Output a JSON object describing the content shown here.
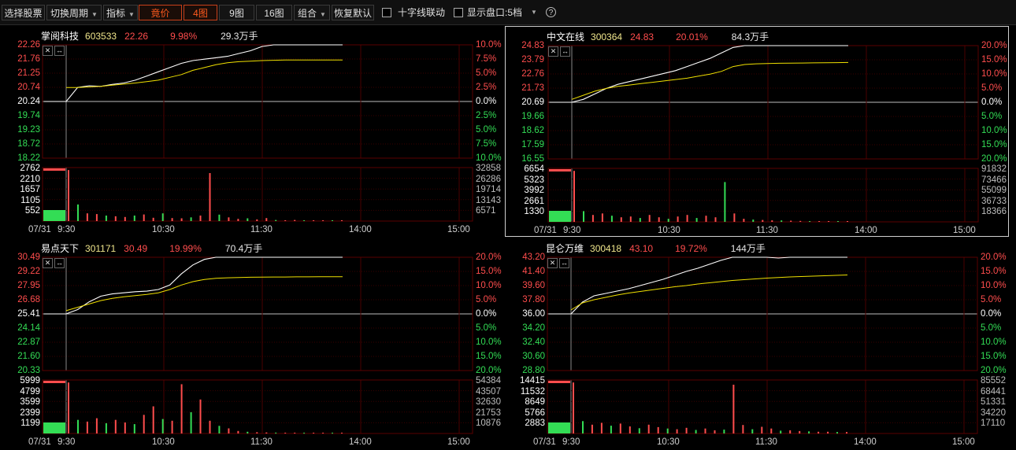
{
  "toolbar": {
    "select_stock": "选择股票",
    "switch_period": "切换周期",
    "indicator": "指标",
    "auction": "竟价",
    "grid4": "4图",
    "grid9": "9图",
    "grid16": "16图",
    "combo": "组合",
    "restore": "恢复默认",
    "crosshair_label": "十字线联动",
    "show_depth_label": "显示盘口:5档",
    "help": "?"
  },
  "colors": {
    "up": "#ff4d4d",
    "down": "#33dd55",
    "price_line": "#ffffff",
    "avg_line": "#f0e000",
    "grid": "#3a0000"
  },
  "time_labels": [
    "9:30",
    "10:30",
    "11:30",
    "14:00",
    "15:00"
  ],
  "panels": [
    {
      "name": "掌阅科技",
      "code": "603533",
      "price": "22.26",
      "pct": "9.98%",
      "vol": "29.3万手",
      "date": "07/31",
      "selected": false,
      "left_prices": [
        "22.26",
        "21.76",
        "21.25",
        "20.74",
        "20.24",
        "19.74",
        "19.23",
        "18.72",
        "18.22"
      ],
      "right_pcts": [
        "10.0%",
        "7.5%",
        "5.0%",
        "2.5%",
        "0.0%",
        "2.5%",
        "5.0%",
        "7.5%",
        "10.0%"
      ],
      "vol_left": [
        "2762",
        "2210",
        "1657",
        "1105",
        "552"
      ],
      "vol_right": [
        "32858",
        "26286",
        "19714",
        "13143",
        "6571"
      ],
      "price_series": [
        20.24,
        20.74,
        20.8,
        20.78,
        20.85,
        20.9,
        21.0,
        21.15,
        21.3,
        21.45,
        21.6,
        21.7,
        21.75,
        21.8,
        21.85,
        21.95,
        22.05,
        22.2,
        22.26,
        22.26,
        22.26,
        22.26,
        22.26,
        22.26,
        22.26
      ],
      "avg_series": [
        20.74,
        20.74,
        20.76,
        20.78,
        20.82,
        20.86,
        20.9,
        20.95,
        21.0,
        21.1,
        21.2,
        21.35,
        21.45,
        21.55,
        21.62,
        21.66,
        21.68,
        21.7,
        21.71,
        21.72,
        21.72,
        21.72,
        21.72,
        21.72,
        21.72
      ],
      "vol_series": [
        2762,
        900,
        420,
        380,
        300,
        260,
        220,
        300,
        360,
        180,
        420,
        160,
        150,
        200,
        300,
        2600,
        350,
        200,
        120,
        150,
        90,
        160,
        60,
        40,
        60,
        30,
        40,
        30,
        20,
        25
      ]
    },
    {
      "name": "中文在线",
      "code": "300364",
      "price": "24.83",
      "pct": "20.01%",
      "vol": "84.3万手",
      "date": "07/31",
      "selected": true,
      "left_prices": [
        "24.83",
        "23.79",
        "22.76",
        "21.73",
        "20.69",
        "19.66",
        "18.62",
        "17.59",
        "16.55"
      ],
      "right_pcts": [
        "20.0%",
        "15.0%",
        "10.0%",
        "5.0%",
        "0.0%",
        "5.0%",
        "10.0%",
        "15.0%",
        "20.0%"
      ],
      "vol_left": [
        "6654",
        "5323",
        "3992",
        "2661",
        "1330"
      ],
      "vol_right": [
        "91832",
        "73466",
        "55099",
        "36733",
        "18366"
      ],
      "price_series": [
        20.69,
        20.9,
        21.3,
        21.7,
        22.0,
        22.2,
        22.4,
        22.6,
        22.8,
        23.0,
        23.3,
        23.6,
        23.9,
        24.3,
        24.7,
        24.83,
        24.83,
        24.83,
        24.83,
        24.83,
        24.83,
        24.83,
        24.83,
        24.83,
        24.83
      ],
      "avg_series": [
        20.9,
        21.2,
        21.5,
        21.7,
        21.85,
        21.95,
        22.05,
        22.15,
        22.25,
        22.35,
        22.45,
        22.6,
        22.75,
        22.95,
        23.3,
        23.45,
        23.5,
        23.52,
        23.54,
        23.55,
        23.56,
        23.57,
        23.58,
        23.59,
        23.6
      ],
      "vol_series": [
        6654,
        1400,
        900,
        1100,
        800,
        600,
        700,
        500,
        900,
        600,
        400,
        700,
        900,
        500,
        800,
        600,
        5200,
        1100,
        400,
        300,
        250,
        200,
        180,
        150,
        120,
        100,
        90,
        80,
        70,
        60
      ]
    },
    {
      "name": "易点天下",
      "code": "301171",
      "price": "30.49",
      "pct": "19.99%",
      "vol": "70.4万手",
      "date": "07/31",
      "selected": false,
      "left_prices": [
        "30.49",
        "29.22",
        "27.95",
        "26.68",
        "25.41",
        "24.14",
        "22.87",
        "21.60",
        "20.33"
      ],
      "right_pcts": [
        "20.0%",
        "15.0%",
        "10.0%",
        "5.0%",
        "0.0%",
        "5.0%",
        "10.0%",
        "15.0%",
        "20.0%"
      ],
      "vol_left": [
        "5999",
        "4799",
        "3599",
        "2399",
        "1199"
      ],
      "vol_right": [
        "54384",
        "43507",
        "32630",
        "21753",
        "10876"
      ],
      "price_series": [
        25.41,
        25.8,
        26.5,
        27.0,
        27.2,
        27.3,
        27.4,
        27.45,
        27.6,
        28.0,
        29.0,
        29.8,
        30.3,
        30.49,
        30.49,
        30.49,
        30.49,
        30.49,
        30.49,
        30.49,
        30.49,
        30.49,
        30.49,
        30.49,
        30.49
      ],
      "avg_series": [
        25.7,
        26.0,
        26.3,
        26.6,
        26.8,
        26.95,
        27.05,
        27.15,
        27.3,
        27.6,
        28.0,
        28.3,
        28.5,
        28.6,
        28.65,
        28.68,
        28.7,
        28.71,
        28.72,
        28.72,
        28.73,
        28.73,
        28.74,
        28.74,
        28.75
      ],
      "vol_series": [
        5999,
        1600,
        1400,
        1800,
        1200,
        1600,
        1300,
        1100,
        2200,
        3200,
        1700,
        1500,
        5800,
        2500,
        4000,
        1500,
        900,
        600,
        300,
        200,
        150,
        120,
        100,
        90,
        80,
        60,
        50,
        40,
        30,
        30
      ]
    },
    {
      "name": "昆仑万维",
      "code": "300418",
      "price": "43.10",
      "pct": "19.72%",
      "vol": "144万手",
      "date": "07/31",
      "selected": false,
      "left_prices": [
        "43.20",
        "41.40",
        "39.60",
        "37.80",
        "36.00",
        "34.20",
        "32.40",
        "30.60",
        "28.80"
      ],
      "right_pcts": [
        "20.0%",
        "15.0%",
        "10.0%",
        "5.0%",
        "0.0%",
        "5.0%",
        "10.0%",
        "15.0%",
        "20.0%"
      ],
      "vol_left": [
        "14415",
        "11532",
        "8649",
        "5766",
        "2883"
      ],
      "vol_right": [
        "85552",
        "68441",
        "51331",
        "34220",
        "17110"
      ],
      "price_series": [
        36.0,
        37.5,
        38.3,
        38.6,
        38.9,
        39.2,
        39.6,
        40.0,
        40.4,
        40.9,
        41.4,
        41.8,
        42.3,
        42.8,
        43.2,
        43.2,
        43.2,
        43.2,
        43.1,
        43.2,
        43.2,
        43.2,
        43.2,
        43.2,
        43.2
      ],
      "avg_series": [
        36.5,
        37.4,
        37.8,
        38.1,
        38.4,
        38.65,
        38.85,
        39.05,
        39.25,
        39.45,
        39.6,
        39.8,
        39.95,
        40.1,
        40.25,
        40.35,
        40.45,
        40.55,
        40.62,
        40.7,
        40.75,
        40.8,
        40.85,
        40.9,
        40.95
      ],
      "vol_series": [
        14415,
        3500,
        2500,
        3000,
        2200,
        2800,
        2000,
        1500,
        2500,
        1800,
        1400,
        1200,
        1600,
        1000,
        1400,
        900,
        1100,
        13800,
        2400,
        1200,
        1900,
        1400,
        800,
        900,
        700,
        600,
        500,
        500,
        400,
        400
      ]
    }
  ]
}
